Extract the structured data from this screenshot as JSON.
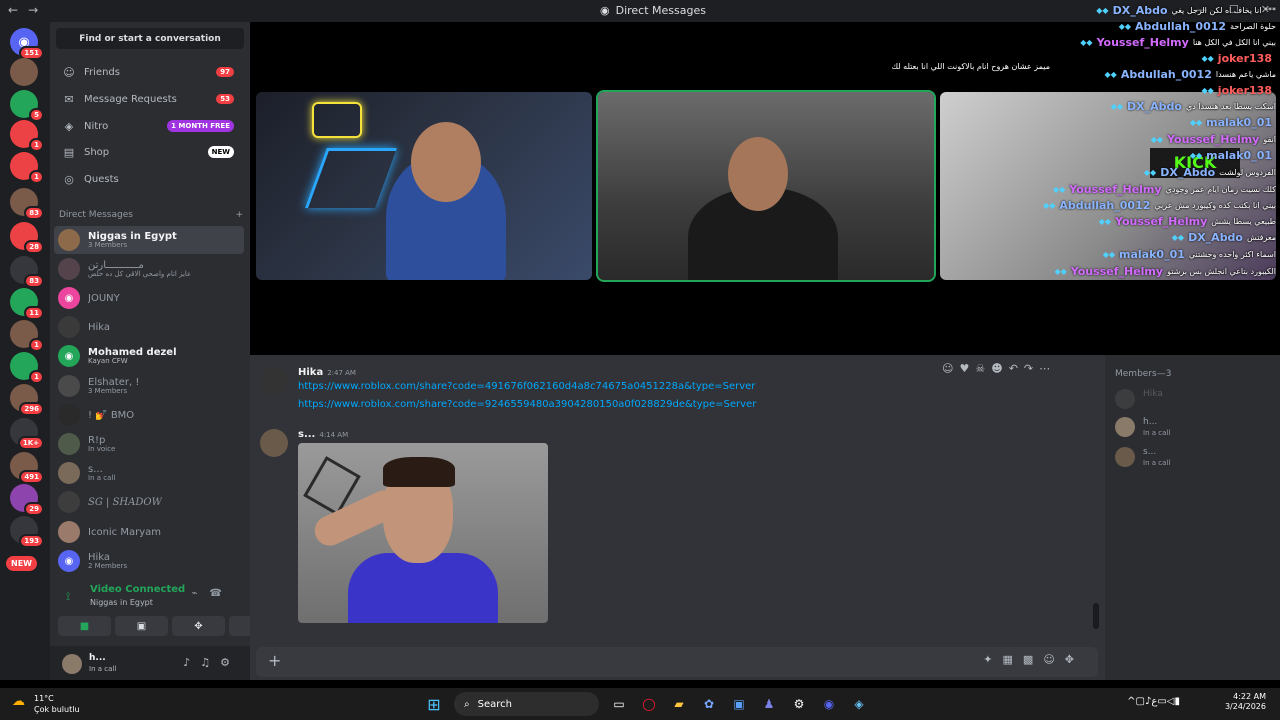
{
  "titlebar": {
    "title": "Direct Messages",
    "back_icon": "←",
    "fwd_icon": "→"
  },
  "rail": {
    "servers": [
      {
        "badge": "151"
      },
      {
        "badge": ""
      },
      {
        "badge": "5"
      },
      {
        "badge": "1"
      },
      {
        "badge": "1"
      },
      {
        "badge": "83"
      },
      {
        "badge": "28"
      },
      {
        "badge": "83"
      },
      {
        "badge": "11"
      },
      {
        "badge": "1"
      },
      {
        "badge": "1"
      },
      {
        "badge": "296"
      },
      {
        "badge": "1K+"
      },
      {
        "badge": "491"
      },
      {
        "badge": "29"
      },
      {
        "badge": "193"
      }
    ],
    "new_label": "NEW"
  },
  "sidebar": {
    "find_label": "Find or start a conversation",
    "nav": [
      {
        "label": "Friends",
        "count": "97"
      },
      {
        "label": "Message Requests",
        "count": "53"
      },
      {
        "label": "Nitro",
        "pill": "1 MONTH FREE"
      },
      {
        "label": "Shop",
        "pill": "NEW"
      },
      {
        "label": "Quests"
      }
    ],
    "dm_header": "Direct Messages",
    "dm_add": "+",
    "dms": [
      {
        "name": "Niggas in Egypt",
        "sub": "3 Members"
      },
      {
        "name": "مـــــــــــارتن",
        "sub": "عايز اتام واصحي الاقي كل ده خلص"
      },
      {
        "name": "JOUNY",
        "sub": ""
      },
      {
        "name": "Hika",
        "sub": ""
      },
      {
        "name": "Mohamed dezel",
        "sub": "Kayan CFW"
      },
      {
        "name": "Elshater, !",
        "sub": "3 Members"
      },
      {
        "name": "! 💅 BMO",
        "sub": ""
      },
      {
        "name": "R!p",
        "sub": "In voice"
      },
      {
        "name": "s...",
        "sub": "In a call"
      },
      {
        "name": "SG | SHADOW",
        "sub": ""
      },
      {
        "name": "Iconic Maryam",
        "sub": ""
      },
      {
        "name": "Hika",
        "sub": "2 Members"
      }
    ]
  },
  "voice": {
    "status": "Video Connected",
    "channel": "Niggas in Egypt"
  },
  "user": {
    "name": "h...",
    "status": "In a call"
  },
  "videos": {
    "kick_text": "KICK"
  },
  "overlay": {
    "lines": [
      {
        "name": "DX_Abdo",
        "msg": "انا يخاف اه لكن الرجل يغي ***",
        "color": "b"
      },
      {
        "name": "Abdullah_0012",
        "msg": "حلوة الصراحة",
        "color": "b"
      },
      {
        "name": "Youssef_Helmy",
        "msg": "بيني انا الكل في الكل هنا",
        "color": "p"
      },
      {
        "name": "joker138",
        "msg": "",
        "color": "r"
      },
      {
        "name": "Abdullah_0012",
        "msg": "ماشي ياعم هنسدا",
        "color": "b"
      },
      {
        "name": "joker138",
        "msg": "",
        "color": "r"
      },
      {
        "name": "DX_Abdo",
        "msg": "اسكت يسطا بعد هنسدا دي",
        "color": "b"
      },
      {
        "name": "malak0_01",
        "msg": "",
        "color": "b"
      },
      {
        "name": "Youssef_Helmy",
        "msg": "انقو",
        "color": "p"
      },
      {
        "name": "malak0_01",
        "msg": "",
        "color": "b"
      },
      {
        "name": "DX_Abdo",
        "msg": "الفردوس لولشت",
        "color": "b"
      },
      {
        "name": "Youssef_Helmy",
        "msg": "كلك نسيت زمان ايام عمر وجودي",
        "color": "p"
      },
      {
        "name": "Abdullah_0012",
        "msg": "بيني انا بكتب كده وكيبورد مش عربي",
        "color": "b"
      },
      {
        "name": "Youssef_Helmy",
        "msg": "طبيعي يسطا يشش",
        "color": "p"
      },
      {
        "name": "DX_Abdo",
        "msg": "معرفتش",
        "color": "b"
      },
      {
        "name": "malak0_01",
        "msg": "اسماء اكثر واحده وحشتني",
        "color": "b"
      },
      {
        "name": "Youssef_Helmy",
        "msg": "الكيبورد بتاعي انجلش بس برشتو",
        "color": "p"
      }
    ],
    "extra_line": "ميمز عشان هروح انام بالاكونت اللي انا بعتله لك"
  },
  "chat": {
    "messages": [
      {
        "author": "Hika",
        "time": "2:47 AM",
        "links": [
          "https://www.roblox.com/share?code=491676f062160d4a8c74675a0451228a&type=Server",
          "https://www.roblox.com/share?code=9246559480a3904280150a0f028829de&type=Server"
        ]
      },
      {
        "author": "s...",
        "time": "4:14 AM"
      }
    ],
    "composer_placeholder": ""
  },
  "members": {
    "header": "Members—3",
    "list": [
      {
        "name": "Hika",
        "status": ""
      },
      {
        "name": "h...",
        "status": "In a call"
      },
      {
        "name": "s...",
        "status": "In a call"
      }
    ]
  },
  "taskbar": {
    "temp": "11°C",
    "weather": "Çok bulutlu",
    "search_label": "Search",
    "time": "4:22 AM",
    "date": "3/24/2026"
  }
}
